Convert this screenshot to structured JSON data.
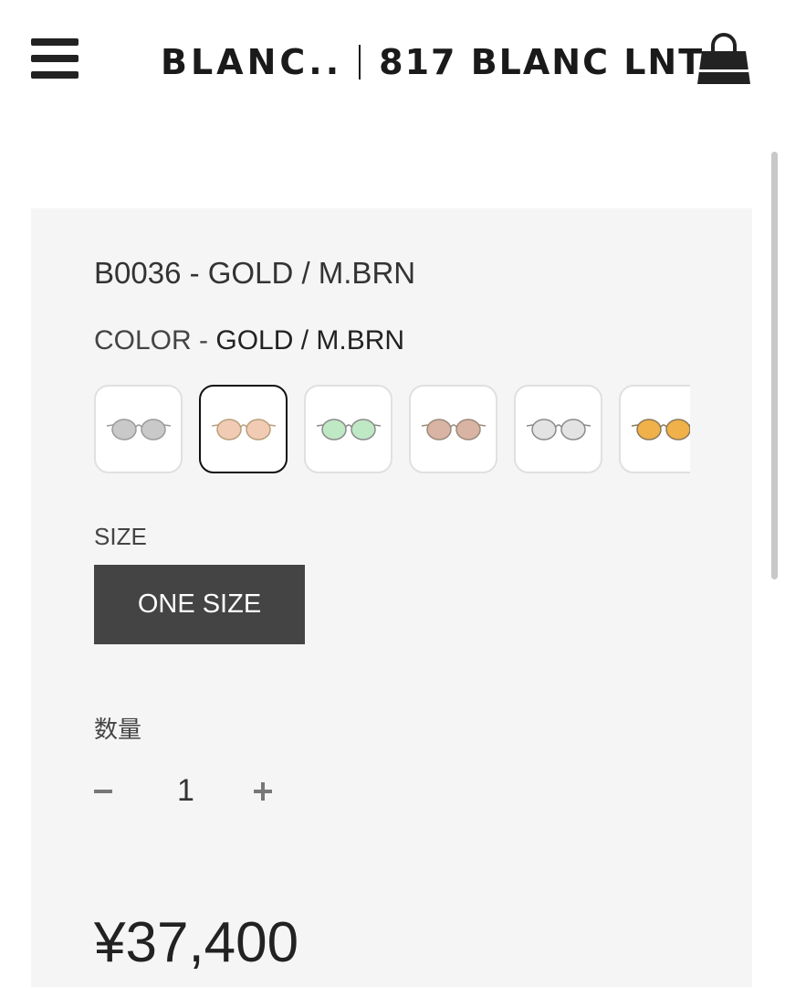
{
  "header": {
    "logo_left": "BLANC..",
    "logo_right": "817 BLANC LNT",
    "menu_icon": "hamburger-menu-icon",
    "cart_icon": "shopping-bag-icon"
  },
  "product": {
    "title": "B0036 - GOLD / M.BRN",
    "color_label": "COLOR",
    "color_sep": " - ",
    "color_value": "GOLD / M.BRN",
    "swatches": [
      {
        "lens": "#c9c9c9",
        "frame": "#9a9a9a",
        "selected": false
      },
      {
        "lens": "#f2cbb5",
        "frame": "#b89f7a",
        "selected": true
      },
      {
        "lens": "#bfe8c4",
        "frame": "#8a8a8a",
        "selected": false
      },
      {
        "lens": "#d9b3a3",
        "frame": "#9a8a7a",
        "selected": false
      },
      {
        "lens": "#e3e3e3",
        "frame": "#8a8a8a",
        "selected": false
      },
      {
        "lens": "#f0b04a",
        "frame": "#8a7a5a",
        "selected": false
      }
    ],
    "size_label": "SIZE",
    "size_option": "ONE SIZE",
    "quantity_label": "数量",
    "quantity_value": "1",
    "price": "¥37,400"
  }
}
